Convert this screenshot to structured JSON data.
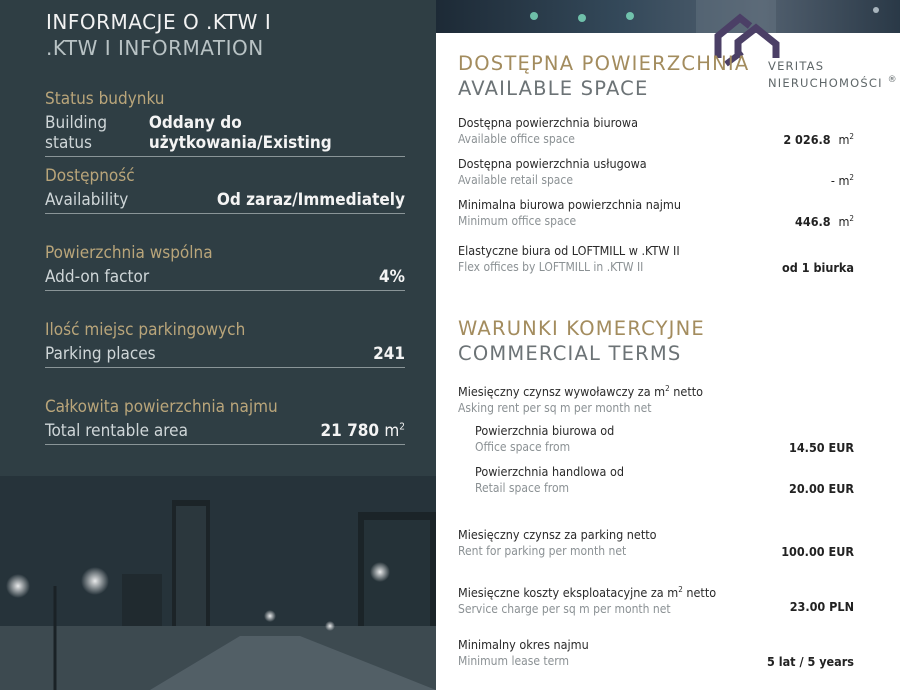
{
  "left": {
    "title_pl": "INFORMACJE O .KTW I",
    "title_en": ".KTW I INFORMATION",
    "facts": [
      {
        "pl": "Status budynku",
        "en": "Building status",
        "value": "Oddany do użytkowania/Existing",
        "unit": ""
      },
      {
        "pl": "Dostępność",
        "en": "Availability",
        "value": "Od zaraz/Immediately",
        "unit": ""
      },
      {
        "pl": "Powierzchnia wspólna",
        "en": "Add-on factor",
        "value": "4%",
        "unit": ""
      },
      {
        "pl": "Ilość miejsc parkingowych",
        "en": "Parking places",
        "value": "241",
        "unit": ""
      },
      {
        "pl": "Całkowita powierzchnia najmu",
        "en": "Total rentable area",
        "value": "21 780",
        "unit": "m",
        "unit_sup": "2"
      }
    ]
  },
  "logo": {
    "line1": "VERITAS",
    "line2": "NIERUCHOMOŚCI",
    "mark": "®"
  },
  "available": {
    "title_pl": "DOSTĘPNA POWIERZCHNIA",
    "title_en": "AVAILABLE SPACE",
    "items": [
      {
        "pl": "Dostępna powierzchnia biurowa",
        "en": "Available office space",
        "value": "2 026.8",
        "unit": "m",
        "unit_sup": "2"
      },
      {
        "pl": "Dostępna powierzchnia usługowa",
        "en": "Available retail space",
        "value": "- m",
        "unit": "",
        "unit_sup": "2"
      },
      {
        "pl": "Minimalna biurowa powierzchnia najmu",
        "en": "Minimum office space",
        "value": "446.8",
        "unit": "m",
        "unit_sup": "2"
      },
      {
        "pl": "Elastyczne biura od LOFTMILL w .KTW II",
        "en": "Flex offices by LOFTMILL in .KTW II",
        "value": "od 1 biurka",
        "unit": "",
        "unit_sup": ""
      }
    ]
  },
  "commercial": {
    "title_pl": "WARUNKI KOMERCYJNE",
    "title_en": "COMMERCIAL TERMS",
    "rent": {
      "pl": "Miesięczny czynsz wywoławczy za m",
      "pl_sup": "2",
      "pl_suffix": " netto",
      "en": "Asking rent per sq m per month net"
    },
    "office": {
      "pl": "Powierzchnia biurowa od",
      "en": "Office space from",
      "value": "14.50 EUR"
    },
    "retail": {
      "pl": "Powierzchnia handlowa od",
      "en": "Retail space from",
      "value": "20.00 EUR"
    },
    "parking": {
      "pl": "Miesięczny czynsz za parking netto",
      "en": "Rent for parking per month net",
      "value": "100.00 EUR"
    },
    "service": {
      "pl": "Miesięczne koszty eksploatacyjne za m",
      "pl_sup": "2",
      "pl_suffix": " netto",
      "en": "Service charge per sq m per month net",
      "value": "23.00 PLN"
    },
    "lease": {
      "pl": "Minimalny okres najmu",
      "en": "Minimum lease term",
      "value": "5 lat / 5 years"
    }
  },
  "colors": {
    "panel": "#2f3e44",
    "gold": "#b9a57a",
    "accent_title": "#a38c5e",
    "logo_purple": "#4b3f66"
  }
}
